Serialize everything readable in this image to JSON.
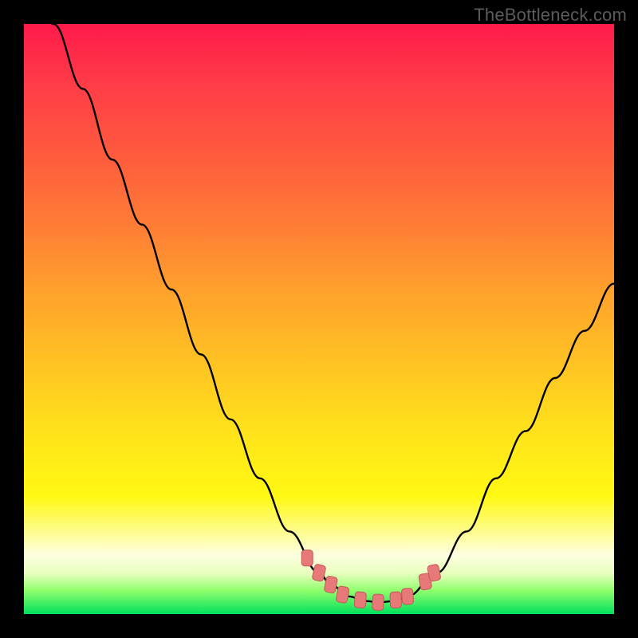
{
  "watermark": "TheBottleneck.com",
  "colors": {
    "frame": "#000000",
    "curve_stroke": "#000000",
    "marker_fill": "#e77a78",
    "marker_stroke": "#c25a58",
    "gradient_top": "#ff1a4a",
    "gradient_bottom": "#00e05c"
  },
  "chart_data": {
    "type": "line",
    "title": "",
    "xlabel": "",
    "ylabel": "",
    "xlim": [
      0,
      100
    ],
    "ylim": [
      0,
      100
    ],
    "grid": false,
    "legend": false,
    "x": [
      0,
      5,
      10,
      15,
      20,
      25,
      30,
      35,
      40,
      45,
      50,
      52,
      55,
      58,
      60,
      63,
      65,
      70,
      75,
      80,
      85,
      90,
      95,
      100
    ],
    "values": [
      110,
      100,
      89,
      77,
      66,
      55,
      44,
      33,
      23,
      14,
      7,
      5,
      3,
      2.2,
      2,
      2.2,
      3,
      7,
      14,
      23,
      31,
      40,
      48,
      56
    ],
    "series": [
      {
        "name": "bottleneck-curve",
        "x": [
          0,
          5,
          10,
          15,
          20,
          25,
          30,
          35,
          40,
          45,
          50,
          52,
          55,
          58,
          60,
          63,
          65,
          70,
          75,
          80,
          85,
          90,
          95,
          100
        ],
        "values": [
          110,
          100,
          89,
          77,
          66,
          55,
          44,
          33,
          23,
          14,
          7,
          5,
          3,
          2.2,
          2,
          2.2,
          3,
          7,
          14,
          23,
          31,
          40,
          48,
          56
        ]
      }
    ],
    "markers": [
      {
        "x": 48,
        "y": 9.5
      },
      {
        "x": 50,
        "y": 7
      },
      {
        "x": 52,
        "y": 5
      },
      {
        "x": 54,
        "y": 3.3
      },
      {
        "x": 57,
        "y": 2.4
      },
      {
        "x": 60,
        "y": 2
      },
      {
        "x": 63,
        "y": 2.4
      },
      {
        "x": 65,
        "y": 3
      },
      {
        "x": 68,
        "y": 5.5
      },
      {
        "x": 69.5,
        "y": 7
      }
    ],
    "marker_style": {
      "shape": "rounded-rect",
      "rx": 4,
      "w": 14,
      "h": 20
    }
  }
}
